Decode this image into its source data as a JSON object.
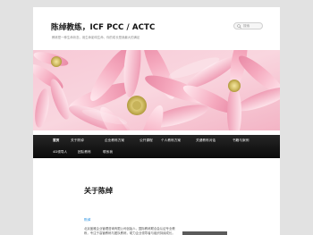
{
  "header": {
    "site_title": "陈绰教练，ICF PCC / ACTC",
    "tagline": "教练是一种生命状态，用生命影响生命，你的成长是我最大的满足"
  },
  "search": {
    "placeholder": "搜索"
  },
  "nav": {
    "row1": [
      {
        "label": "首页",
        "active": true
      },
      {
        "label": "关于陈绰"
      },
      {
        "label": "企业教练方案"
      },
      {
        "label": "公开课程"
      },
      {
        "label": "个人教练方案"
      },
      {
        "label": "关键教练对话"
      },
      {
        "label": "书籍与案例"
      }
    ],
    "row2": [
      {
        "label": "4D领导人"
      },
      {
        "label": "团队教练"
      },
      {
        "label": "联系我"
      }
    ]
  },
  "content": {
    "heading": "关于陈绰",
    "section_title": "陈绰",
    "paragraph": "北京盖雅企业管理咨询有限公司创始人，国际教练联合会认证专业教练，专注于高管教练与团队教练，助力企业领导者与组织持续成长。"
  },
  "colors": {
    "nav_bg": "#1a1a1a",
    "link": "#1b8be0",
    "page_bg": "#e2e2e2"
  }
}
